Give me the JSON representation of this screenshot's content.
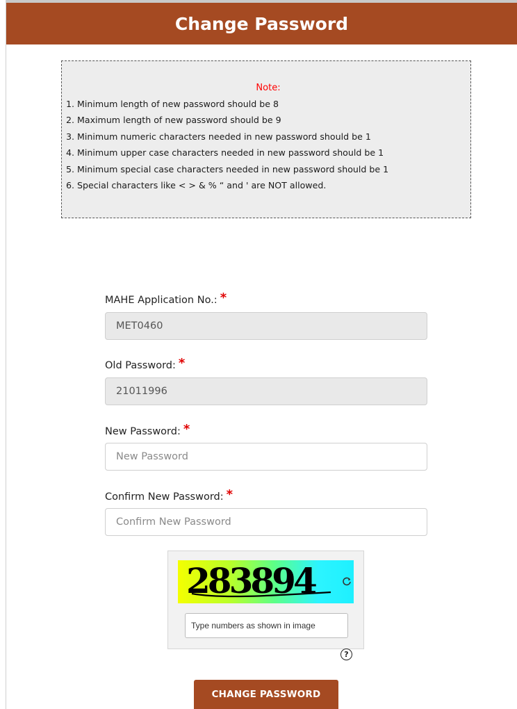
{
  "header": {
    "title": "Change Password"
  },
  "note": {
    "title": "Note:",
    "lines": [
      "1. Minimum length of new password should be 8",
      "2. Maximum length of new password should be 9",
      "3. Minimum numeric characters needed in new password should be 1",
      "4. Minimum upper case characters needed in new password should be 1",
      "5. Minimum special case characters needed in new password should be 1",
      "6. Special characters like < > & % “ and ' are NOT allowed."
    ]
  },
  "form": {
    "required_mark": "*",
    "application_no": {
      "label": "MAHE Application No.:",
      "value": "MET0460"
    },
    "old_password": {
      "label": "Old Password:",
      "value": "21011996"
    },
    "new_password": {
      "label": "New Password:",
      "placeholder": "New Password"
    },
    "confirm_password": {
      "label": "Confirm New Password:",
      "placeholder": "Confirm New Password"
    }
  },
  "captcha": {
    "code": "283894",
    "input_placeholder": "Type numbers as shown in image",
    "refresh_icon": "refresh-icon",
    "help_icon": "help-icon",
    "help_symbol": "?"
  },
  "actions": {
    "submit_label": "CHANGE PASSWORD"
  },
  "colors": {
    "brand": "#a54a22",
    "note_title": "#ff0000",
    "required": "#e00000"
  }
}
